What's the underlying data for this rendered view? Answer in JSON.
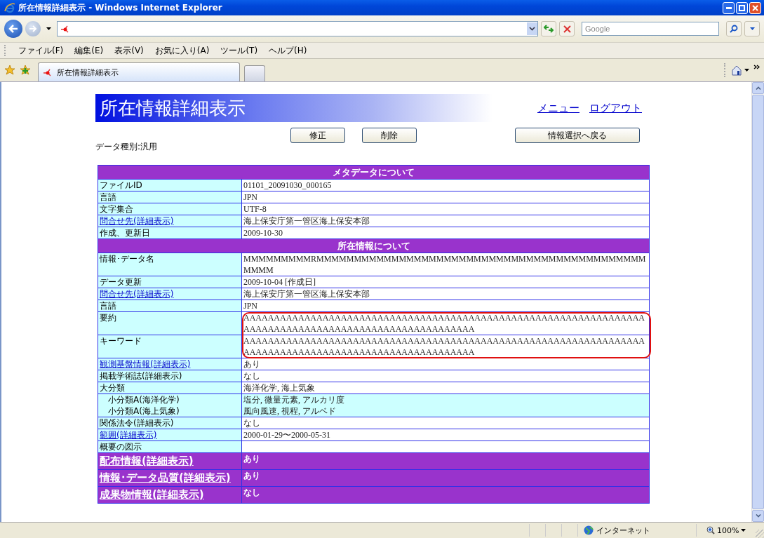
{
  "window": {
    "title": "所在情報詳細表示 - Windows Internet Explorer"
  },
  "search": {
    "placeholder": "Google"
  },
  "menu": [
    "ファイル(F)",
    "編集(E)",
    "表示(V)",
    "お気に入り(A)",
    "ツール(T)",
    "ヘルプ(H)"
  ],
  "tabs": [
    {
      "label": "所在情報詳細表示",
      "selected": true
    }
  ],
  "page": {
    "heading": "所在情報詳細表示",
    "links": [
      "メニュー",
      "ログアウト"
    ],
    "data_type": "データ種別:汎用",
    "buttons": [
      "修正",
      "削除"
    ],
    "back_button": "情報選択へ戻る",
    "rows": [
      {
        "kind": "heading",
        "label": "メタデータについて"
      },
      {
        "kind": "field",
        "label": "ファイルID",
        "link": false,
        "value": "01101_20091030_000165"
      },
      {
        "kind": "field",
        "label": "言語",
        "link": false,
        "value": "JPN"
      },
      {
        "kind": "field",
        "label": "文字集合",
        "link": false,
        "value": "UTF-8"
      },
      {
        "kind": "field",
        "label": "問合せ先(詳細表示)",
        "link": true,
        "value": "海上保安庁第一管区海上保安本部"
      },
      {
        "kind": "field",
        "label": "作成、更新日",
        "link": false,
        "value": "2009-10-30"
      },
      {
        "kind": "heading",
        "label": "所在情報について"
      },
      {
        "kind": "field",
        "label": "情報･データ名",
        "link": false,
        "value": "MMMMMMMMMRMMMMMMMMMMMMMMMMMMMMMMMMMMMMMMMMMMMMMMMMMMMMMMMM"
      },
      {
        "kind": "field",
        "label": "データ更新",
        "link": false,
        "value": "2009-10-04  [作成日]"
      },
      {
        "kind": "field",
        "label": "問合せ先(詳細表示)",
        "link": true,
        "value": "海上保安庁第一管区海上保安本部"
      },
      {
        "kind": "field",
        "label": "言語",
        "link": false,
        "value": "JPN"
      },
      {
        "kind": "field",
        "label": "要約",
        "link": false,
        "value": "AAAAAAAAAAAAAAAAAAAAAAAAAAAAAAAAAAAAAAAAAAAAAAAAAAAAAAAAAAAAAAAAAAAAAAAAAAAAAAAAAAAAAAAAAAAAAAAAAAAAAAAA"
      },
      {
        "kind": "field",
        "label": "キーワード",
        "link": false,
        "value": "AAAAAAAAAAAAAAAAAAAAAAAAAAAAAAAAAAAAAAAAAAAAAAAAAAAAAAAAAAAAAAAAAAAAAAAAAAAAAAAAAAAAAAAAAAAAAAAAAAAAAAAA"
      },
      {
        "kind": "field",
        "label": "観測基盤情報(詳細表示)",
        "link": true,
        "value": "あり"
      },
      {
        "kind": "field",
        "label": "掲載学術誌(詳細表示)",
        "link": false,
        "value": "なし"
      },
      {
        "kind": "field",
        "label": "大分類",
        "link": false,
        "value": "海洋化学, 海上気象"
      },
      {
        "kind": "sub",
        "label": "小分類A(海洋化学)",
        "value": "塩分, 微量元素, アルカリ度"
      },
      {
        "kind": "sub",
        "label": "小分類A(海上気象)",
        "value": "風向風速, 視程, アルベド"
      },
      {
        "kind": "field",
        "label": "関係法令(詳細表示)",
        "link": false,
        "value": "なし"
      },
      {
        "kind": "field",
        "label": "範囲(詳細表示)",
        "link": true,
        "value": "2000-01-29〜2000-05-31"
      },
      {
        "kind": "field",
        "label": "概要の図示",
        "link": false,
        "value": ""
      },
      {
        "kind": "section",
        "label": "配布情報(詳細表示)",
        "value": "あり"
      },
      {
        "kind": "section",
        "label": "情報･データ品質(詳細表示)",
        "value": "あり"
      },
      {
        "kind": "section",
        "label": "成果物情報(詳細表示)",
        "value": "なし"
      }
    ]
  },
  "status_bar": {
    "zone": "インターネット",
    "zoom": "100%"
  }
}
